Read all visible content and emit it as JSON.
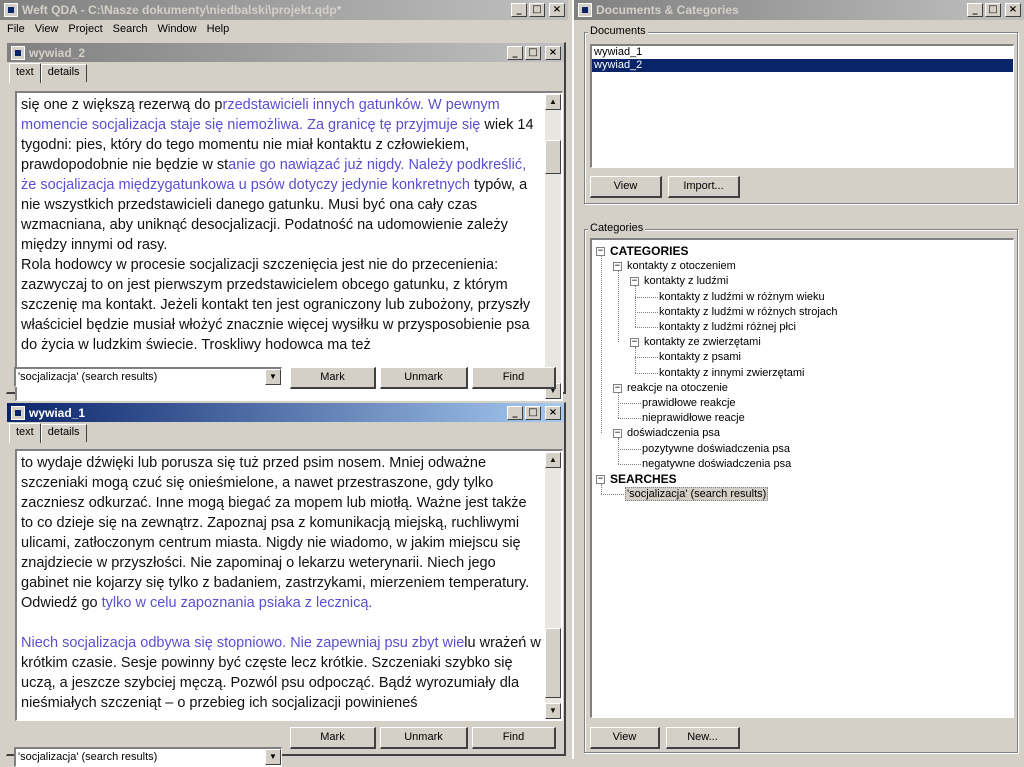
{
  "app": {
    "title": "Weft QDA - C:\\Nasze dokumenty\\niedbalski\\projekt.qdp*",
    "menu": [
      "File",
      "View",
      "Project",
      "Search",
      "Window",
      "Help"
    ]
  },
  "doc_windows": [
    {
      "title": "wywiad_2",
      "tabs": [
        "text",
        "details"
      ],
      "text_html": "się one z większą rezerwą do p<span class=\"hl\">rzedstawicieli innych gatunków. W pewnym momencie socjalizacja staje się niemożliwa. Za granicę tę przyjmuje się</span> wiek 14 tygodni: pies, który do tego momentu nie miał kontaktu z człowiekiem, prawdopodobnie nie będzie w st<span class=\"hl\">anie go nawiązać już nigdy. Należy podkreślić, że socjalizacja międzygatunkowa u psów dotyczy jedynie konkretnych</span> typów, a nie wszystkich przedstawicieli danego gatunku. Musi być ona cały czas wzmacniana, aby uniknąć desocjalizacji. Podatność na udomowienie zależy między innymi od rasy.<br>Rola hodowcy w procesie socjalizacji szczenięcia jest nie do przecenienia: zazwyczaj to on jest pierwszym przedstawicielem obcego gatunku, z którym szczenię ma kontakt. Jeżeli kontakt ten jest ograniczony lub zubożony, przyszły właściciel będzie musiał włożyć znacznie więcej wysiłku w przysposobienie psa do życia w ludzkim świecie. Troskliwy hodowca ma też",
      "search": "'socjalizacja' (search results)",
      "buttons": [
        "Mark",
        "Unmark",
        "Find"
      ]
    },
    {
      "title": "wywiad_1",
      "tabs": [
        "text",
        "details"
      ],
      "text_html": "to wydaje dźwięki lub porusza się tuż przed psim nosem. Mniej odważne szczeniaki mogą czuć się onieśmielone, a nawet przestraszone, gdy tylko zaczniesz odkurzać. Inne mogą biegać za mopem lub miotłą. Ważne jest także to co dzieje się na zewnątrz. Zapoznaj psa z komunikacją miejską, ruchliwymi ulicami, zatłoczonym centrum miasta. Nigdy nie wiadomo, w jakim miejscu się znajdziecie w przyszłości. Nie zapominaj o lekarzu weterynarii. Niech jego gabinet nie kojarzy się tylko z badaniem, zastrzykami, mierzeniem temperatury. Odwiedź go <span class=\"hl\">tylko w celu zapoznania psiaka z lecznicą.</span><br><br><span class=\"hl\">Niech socjalizacja odbywa się stopniowo. Nie zapewniaj psu zbyt wie</span>lu wrażeń w krótkim czasie. Sesje powinny być częste lecz krótkie. Szczeniaki szybko się uczą, a jeszcze szybciej męczą. Pozwól psu odpocząć. Bądź wyrozumiały dla nieśmiałych szczeniąt – o przebieg ich socjalizacji powinieneś",
      "search": "'socjalizacja' (search results)",
      "buttons": [
        "Mark",
        "Unmark",
        "Find"
      ]
    }
  ],
  "right_window": {
    "title": "Documents & Categories",
    "documents_label": "Documents",
    "documents": [
      "wywiad_1",
      "wywiad_2"
    ],
    "selected_document": 1,
    "doc_buttons": [
      "View",
      "Import..."
    ],
    "categories_label": "Categories",
    "tree": [
      {
        "label": "CATEGORIES",
        "level": 0,
        "bold": true,
        "expander": "−"
      },
      {
        "label": "kontakty z otoczeniem",
        "level": 1,
        "expander": "−"
      },
      {
        "label": "kontakty z ludźmi",
        "level": 2,
        "expander": "−"
      },
      {
        "label": "kontakty z ludźmi w różnym wieku",
        "level": 3
      },
      {
        "label": "kontakty z ludźmi w różnych strojach",
        "level": 3
      },
      {
        "label": "kontakty z ludźmi różnej płci",
        "level": 3
      },
      {
        "label": "kontakty ze zwierzętami",
        "level": 2,
        "expander": "−"
      },
      {
        "label": "kontakty z psami",
        "level": 3
      },
      {
        "label": "kontakty z innymi zwierzętami",
        "level": 3
      },
      {
        "label": "reakcje na otoczenie",
        "level": 1,
        "expander": "−"
      },
      {
        "label": "prawidłowe reakcje",
        "level": 2
      },
      {
        "label": "nieprawidłowe reacje",
        "level": 2
      },
      {
        "label": "doświadczenia psa",
        "level": 1,
        "expander": "−"
      },
      {
        "label": "pozytywne doświadczenia psa",
        "level": 2
      },
      {
        "label": "negatywne doświadczenia psa",
        "level": 2
      },
      {
        "label": "SEARCHES",
        "level": 0,
        "bold": true,
        "expander": "−"
      },
      {
        "label": "'socjalizacja' (search results)",
        "level": 1,
        "selected": true
      }
    ],
    "cat_buttons": [
      "View",
      "New..."
    ]
  }
}
